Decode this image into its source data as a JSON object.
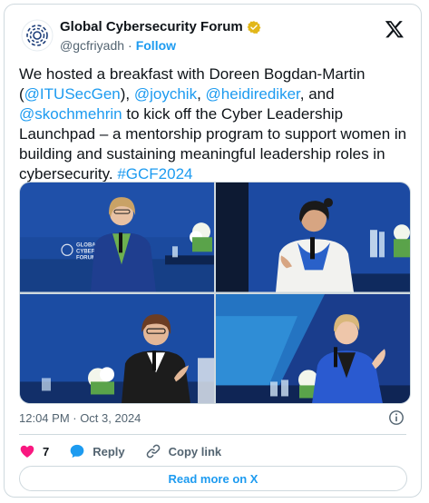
{
  "author": {
    "display_name": "Global Cybersecurity Forum",
    "handle": "@gcfriyadh",
    "separator": "·",
    "follow_label": "Follow"
  },
  "tweet": {
    "parts": [
      {
        "text": "We hosted a breakfast with Doreen Bogdan-Martin (",
        "type": "text"
      },
      {
        "text": "@ITUSecGen",
        "type": "mention"
      },
      {
        "text": "), ",
        "type": "text"
      },
      {
        "text": "@joychik",
        "type": "mention"
      },
      {
        "text": ", ",
        "type": "text"
      },
      {
        "text": "@heidirediker",
        "type": "mention"
      },
      {
        "text": ", and ",
        "type": "text"
      },
      {
        "text": "@skochmehrin",
        "type": "mention"
      },
      {
        "text": " to kick off the Cyber Leadership Launchpad – a mentorship program to support women in building and sustaining meaningful leadership roles in cybersecurity. ",
        "type": "text"
      },
      {
        "text": "#GCF2024",
        "type": "hashtag"
      }
    ]
  },
  "media": {
    "photos": [
      {
        "name": "photo-speaker-1"
      },
      {
        "name": "photo-speaker-2"
      },
      {
        "name": "photo-speaker-3"
      },
      {
        "name": "photo-speaker-4"
      }
    ],
    "backdrop_text": [
      "GLOBAL",
      "CYBER",
      "FORUM"
    ]
  },
  "meta": {
    "timestamp": "12:04 PM · Oct 3, 2024"
  },
  "actions": {
    "like_count": "7",
    "reply_label": "Reply",
    "copy_link_label": "Copy link"
  },
  "footer": {
    "read_more_label": "Read more on X"
  },
  "colors": {
    "accent": "#1d9bf0",
    "like": "#f91880",
    "verified_badge": "#e2b719",
    "backdrop_blue": "#1d4fa8"
  }
}
